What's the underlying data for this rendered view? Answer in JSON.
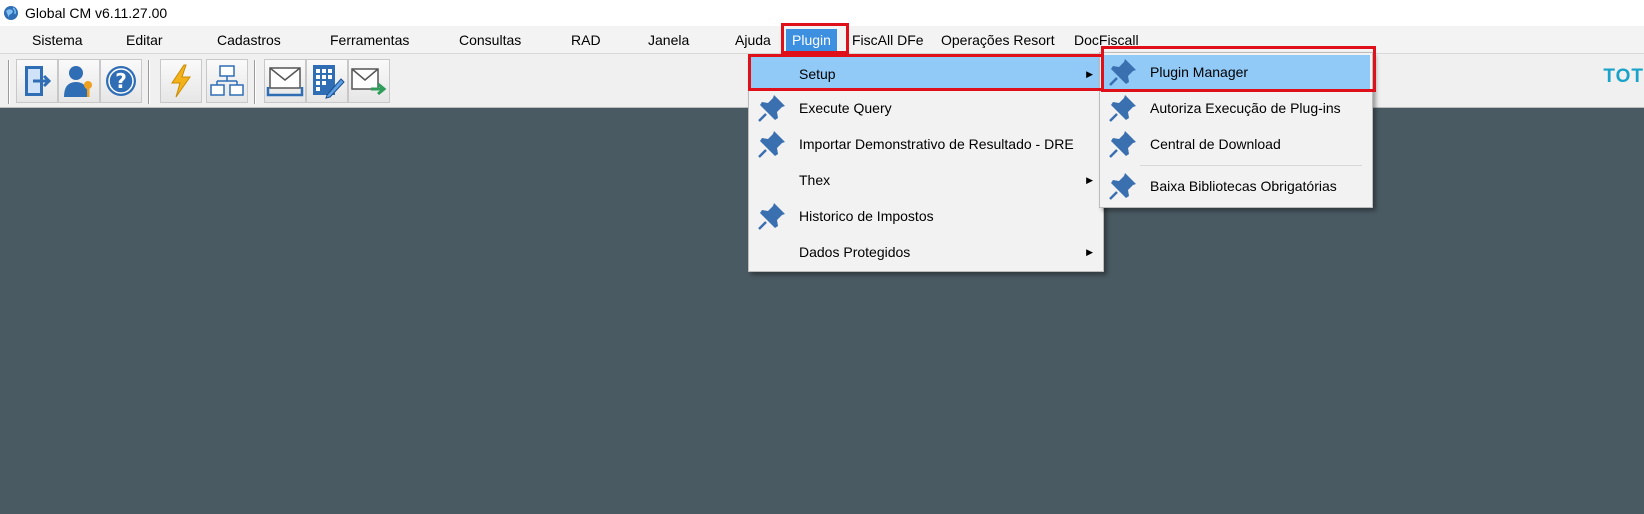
{
  "window": {
    "title": "Global CM v6.11.27.00"
  },
  "menubar": {
    "items": [
      "Sistema",
      "Editar",
      "Cadastros",
      "Ferramentas",
      "Consultas",
      "RAD",
      "Janela",
      "Ajuda",
      "Plugin",
      "FiscAll DFe",
      "Operações Resort",
      "DocFiscall"
    ],
    "active": "Plugin"
  },
  "toolbar": {
    "buttons": [
      "exit-icon",
      "user-key-icon",
      "help-icon",
      "lightning-icon",
      "org-chart-icon",
      "mail-tray-icon",
      "calculator-edit-icon",
      "mail-send-icon"
    ]
  },
  "brand": {
    "text": "TOT"
  },
  "plugin_menu": {
    "items": [
      {
        "label": "Setup",
        "icon": "",
        "submenu": true
      },
      {
        "label": "Execute Query",
        "icon": "pin-icon",
        "submenu": false
      },
      {
        "label": "Importar Demonstrativo de Resultado - DRE",
        "icon": "pin-icon",
        "submenu": false
      },
      {
        "label": "Thex",
        "icon": "",
        "submenu": true
      },
      {
        "label": "Historico de Impostos",
        "icon": "pin-icon",
        "submenu": false
      },
      {
        "label": "Dados Protegidos",
        "icon": "",
        "submenu": true
      }
    ]
  },
  "setup_submenu": {
    "items": [
      {
        "label": "Plugin Manager",
        "icon": "pin-icon"
      },
      {
        "label": "Autoriza Execução de Plug-ins",
        "icon": "pin-icon"
      },
      {
        "label": "Central de Download",
        "icon": "pin-icon"
      },
      {
        "label": "Baixa Bibliotecas Obrigatórias",
        "icon": "pin-icon"
      }
    ]
  },
  "colors": {
    "desktop": "#4a5a62",
    "menu_highlight": "#91c9f7",
    "active_menu": "#3d8fe0",
    "annotation": "#e0101a",
    "pin": "#3a6fb0"
  }
}
